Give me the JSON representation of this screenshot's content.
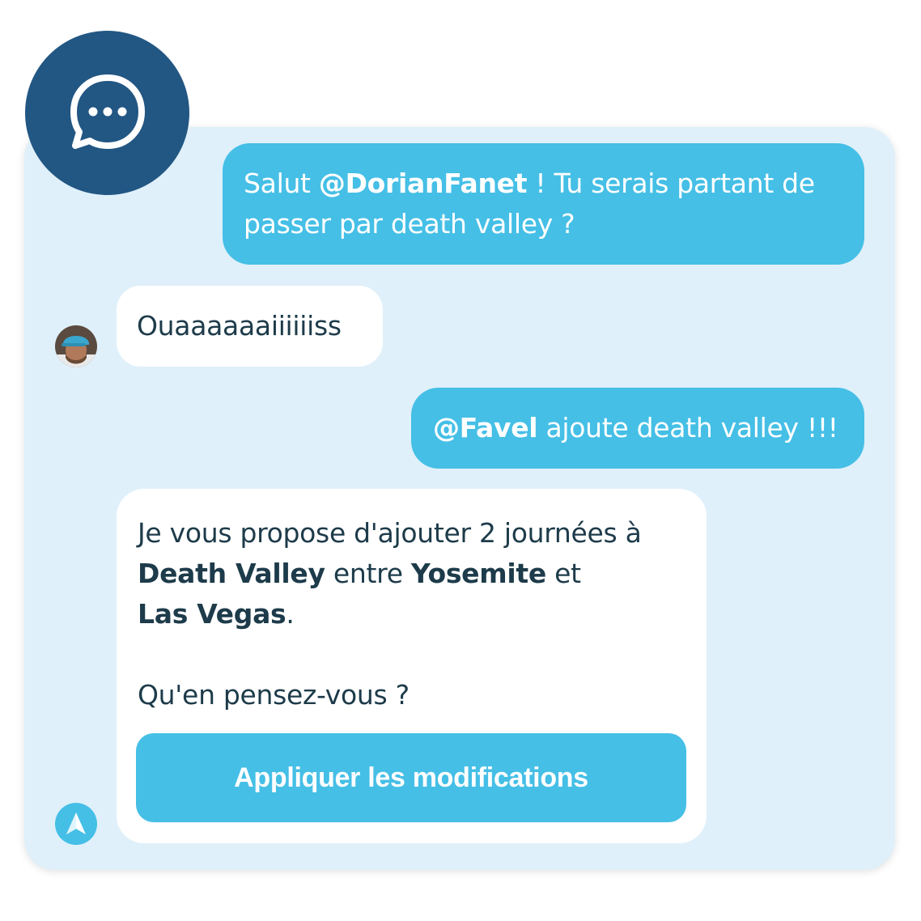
{
  "header": {
    "icon": "chat-bubble-dots-icon"
  },
  "colors": {
    "badge": "#225683",
    "panel": "#dff0fa",
    "accent": "#45bfe6",
    "text": "#1d3b4a"
  },
  "messages": [
    {
      "direction": "outgoing",
      "parts": [
        "Salut ",
        "@DorianFanet",
        " ! Tu serais partant de passer par death valley ?"
      ]
    },
    {
      "direction": "incoming",
      "sender_avatar": "user-avatar",
      "text": "Ouaaaaaaiiiiiiss"
    },
    {
      "direction": "outgoing",
      "parts": [
        "@Favel",
        " ajoute death valley !!!"
      ]
    },
    {
      "direction": "incoming",
      "sender_avatar": "bot-avatar",
      "parts": [
        "Je vous propose d'ajouter 2 journées à ",
        "Death Valley",
        " entre ",
        "Yosemite",
        " et ",
        "Las Vegas",
        "."
      ],
      "question": "Qu'en pensez-vous ?",
      "action_label": "Appliquer les modifications"
    }
  ]
}
